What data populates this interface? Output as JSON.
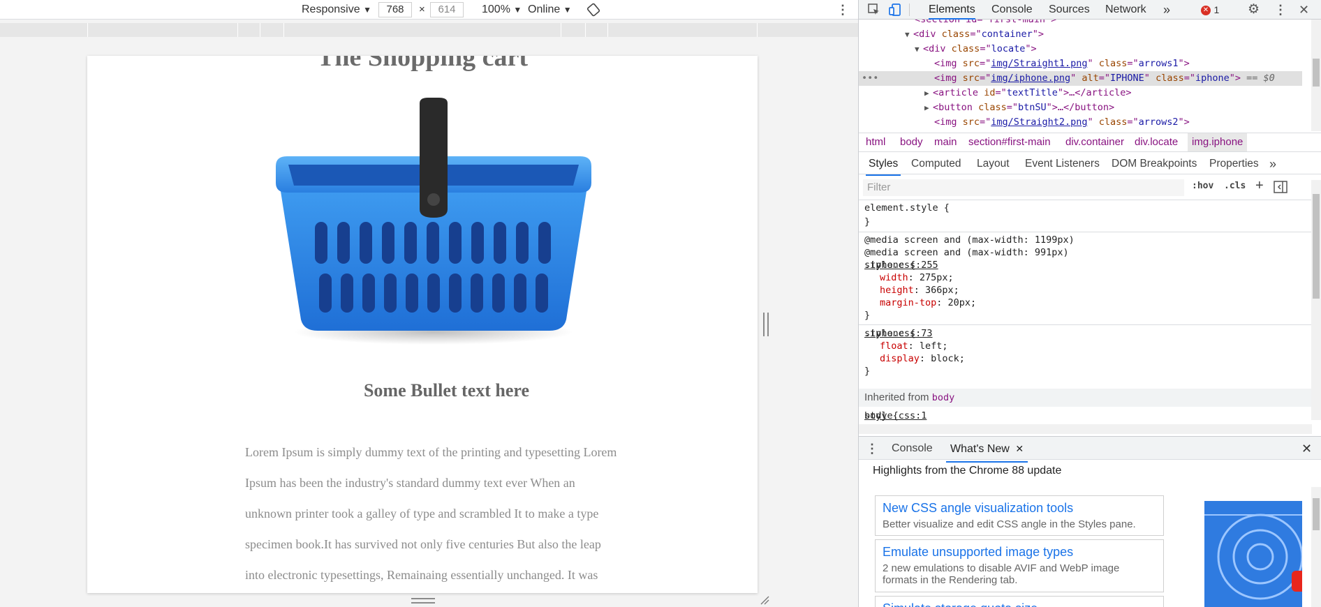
{
  "device_toolbar": {
    "mode": "Responsive",
    "width": "768",
    "times": "×",
    "height": "614",
    "zoom": "100%",
    "network": "Online"
  },
  "page": {
    "title": "The Shopping cart",
    "subtitle": "Some Bullet text here",
    "body_lines": [
      "Lorem Ipsum is simply dummy text of the printing and typesetting Lorem",
      "Ipsum has been the industry's standard dummy text ever When an",
      "unknown printer took a galley of type and scrambled It to make a type",
      "specimen book.It has survived not only five centuries But also the leap",
      "into electronic typesettings, Remainaing essentially unchanged. It was"
    ]
  },
  "devtools": {
    "tabs": [
      "Elements",
      "Console",
      "Sources",
      "Network"
    ],
    "error_count": "1",
    "dom": {
      "r0": "section id=\"first-main\"",
      "r1_tag": "div",
      "r1_attr": "class",
      "r1_val": "container",
      "r2_tag": "div",
      "r2_attr": "class",
      "r2_val": "locate",
      "r3_src": "img/Straight1.png",
      "r3_cls": "arrows1",
      "r4_src": "img/iphone.png",
      "r4_alt": "IPHONE",
      "r4_cls": "iphone",
      "r4_suffix": "== $0",
      "r5_tag": "article",
      "r5_attr": "id",
      "r5_val": "textTitle",
      "r5_close": "article",
      "r6_tag": "button",
      "r6_attr": "class",
      "r6_val": "btnSU",
      "r6_close": "button",
      "r7_src": "img/Straight2.png",
      "r7_cls": "arrows2"
    },
    "breadcrumbs": [
      "html",
      "body",
      "main",
      "section#first-main",
      "div.container",
      "div.locate",
      "img.iphone"
    ],
    "sub_tabs": [
      "Styles",
      "Computed",
      "Layout",
      "Event Listeners",
      "DOM Breakpoints",
      "Properties"
    ],
    "filter_placeholder": "Filter",
    "hov": ":hov",
    "cls": ".cls",
    "styles": {
      "element_style_open": "element.style {",
      "close": "}",
      "media1": "@media screen and (max-width: 1199px)",
      "media2": "@media screen and (max-width: 991px)",
      "rule1_selector": ".iphone {",
      "rule1_source": "style.css:255",
      "rule1_props": [
        {
          "name": "width",
          "value": "275px;"
        },
        {
          "name": "height",
          "value": "366px;"
        },
        {
          "name": "margin-top",
          "value": "20px;"
        }
      ],
      "rule2_selector": ".iphone {",
      "rule2_source": "style.css:73",
      "rule2_props": [
        {
          "name": "float",
          "value": "left;"
        },
        {
          "name": "display",
          "value": "block;"
        }
      ],
      "inherited_label": "Inherited from",
      "inherited_tag": "body",
      "rule3_selector": "body {",
      "rule3_source": "style.css:1"
    },
    "drawer": {
      "tabs": [
        "Console",
        "What's New"
      ],
      "highlights": "Highlights from the Chrome 88 update",
      "cards": [
        {
          "title": "New CSS angle visualization tools",
          "desc": "Better visualize and edit CSS angle in the Styles pane."
        },
        {
          "title": "Emulate unsupported image types",
          "desc": "2 new emulations to disable AVIF and WebP image formats in the Rendering tab."
        },
        {
          "title": "Simulate storage quota size",
          "desc": ""
        }
      ]
    },
    "colors": {
      "accent": "#1a73e8",
      "error": "#d93025",
      "tag": "#881280"
    }
  }
}
